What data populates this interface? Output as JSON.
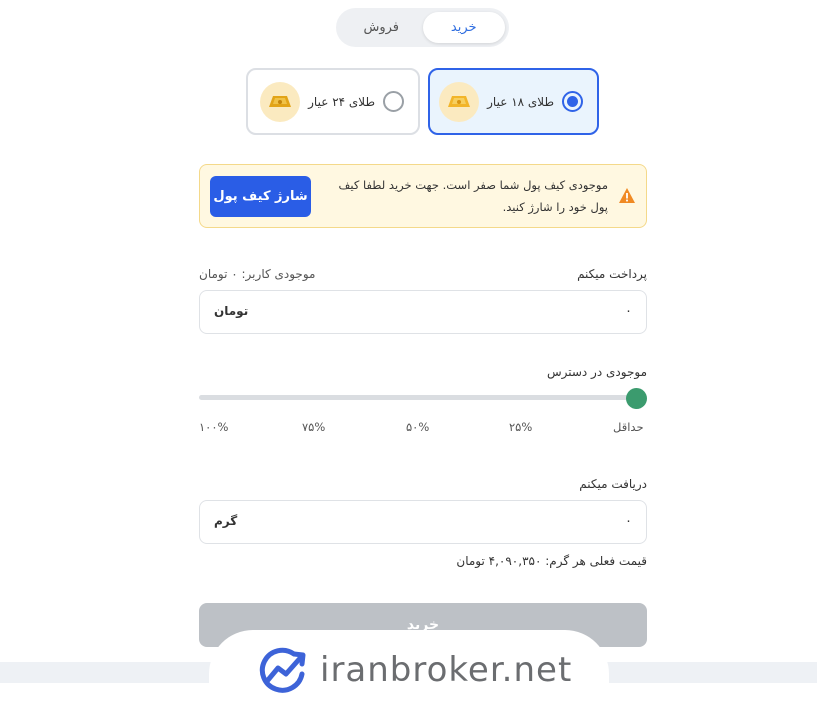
{
  "tabs": {
    "buy": "خرید",
    "sell": "فروش",
    "active": "buy"
  },
  "gold_types": [
    {
      "label": "طلای ۱۸ عیار",
      "selected": true,
      "icon": "gold-bar-icon"
    },
    {
      "label": "طلای ۲۴ عیار",
      "selected": false,
      "icon": "gold-bar-icon"
    }
  ],
  "alert": {
    "icon": "warning-icon",
    "message": "موجودی کیف پول شما صفر است. جهت خرید لطفا کیف پول خود را شارژ کنید.",
    "button": "شارژ کیف پول"
  },
  "pay": {
    "label": "پرداخت میکنم",
    "balance": "موجودی کاربر: ۰ تومان",
    "value": "۰",
    "unit": "تومان"
  },
  "available": {
    "label": "موجودی در دسترس",
    "ticks": [
      "حداقل",
      "۲۵%",
      "۵۰%",
      "۷۵%",
      "۱۰۰%"
    ],
    "level": 0
  },
  "receive": {
    "label": "دریافت میکنم",
    "value": "۰",
    "unit": "گرم",
    "price": "قیمت فعلی هر گرم: ۴,۰۹۰,۳۵۰ تومان"
  },
  "buy_button": "خرید",
  "watermark": {
    "text": "iranbroker.net",
    "icon": "growth-chart-icon"
  },
  "colors": {
    "primary": "#2a5de6",
    "slider": "#3b9b6e",
    "alert_bg": "#fff8e1",
    "warning": "#f08a24"
  }
}
